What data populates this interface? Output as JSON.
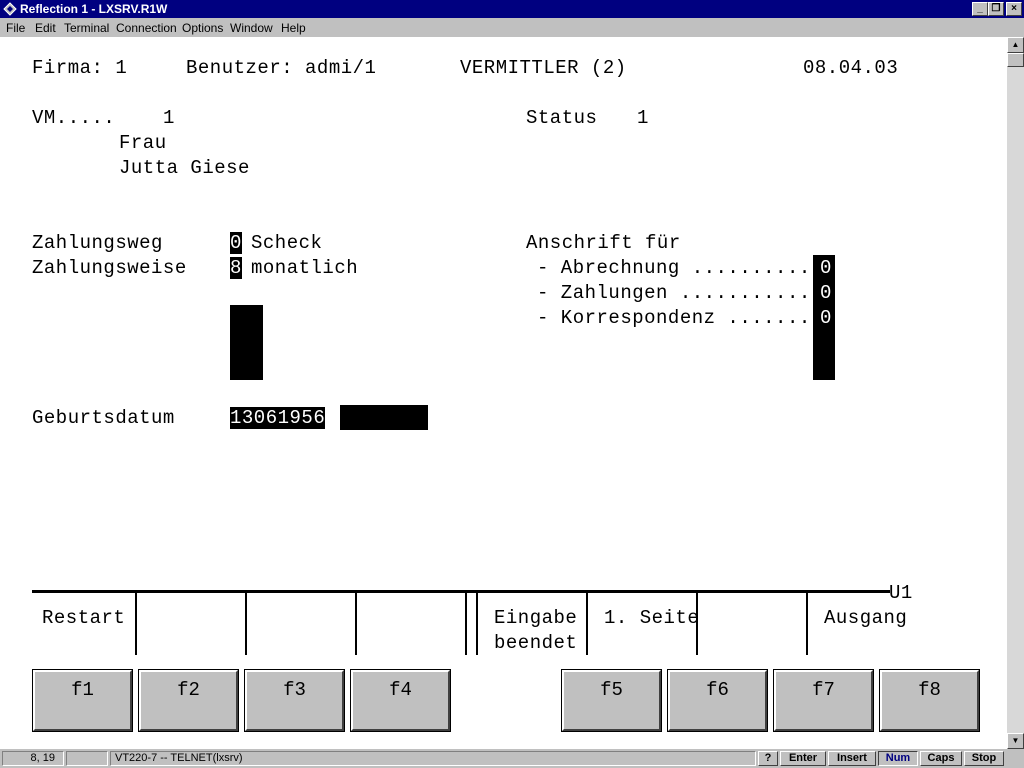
{
  "window": {
    "title": "Reflection 1 - LXSRV.R1W"
  },
  "menu": [
    "File",
    "Edit",
    "Terminal",
    "Connection",
    "Options",
    "Window",
    "Help"
  ],
  "header": {
    "firma": "Firma: 1",
    "benutzer": "Benutzer: admi/1",
    "screen_title": "VERMITTLER (2)",
    "date": "08.04.03"
  },
  "record": {
    "vm_label": "VM.....",
    "vm_value": "1",
    "status_label": "Status",
    "status_value": "1",
    "salutation": "Frau",
    "name": "Jutta Giese"
  },
  "payment": {
    "weg_label": "Zahlungsweg",
    "weg_value": "0",
    "weg_text": "Scheck",
    "weise_label": "Zahlungsweise",
    "weise_value": "8",
    "weise_text": "monatlich"
  },
  "address": {
    "header": "Anschrift für",
    "rows": [
      {
        "label": "- Abrechnung ..........",
        "value": "0"
      },
      {
        "label": "- Zahlungen ...........",
        "value": "0"
      },
      {
        "label": "- Korrespondenz .......",
        "value": "0"
      }
    ]
  },
  "birth": {
    "label": "Geburtsdatum",
    "value": "13061956"
  },
  "screen_id": "U1",
  "softkeys": {
    "f1": "Restart",
    "f5_line1": "Eingabe",
    "f5_line2": "beendet",
    "f6": "1. Seite",
    "f8": "Ausgang"
  },
  "fkeys": [
    "f1",
    "f2",
    "f3",
    "f4",
    "f5",
    "f6",
    "f7",
    "f8"
  ],
  "status": {
    "cursor": "8, 19",
    "session": "VT220-7 -- TELNET(lxsrv)",
    "indicators": [
      "?",
      "Enter",
      "Insert",
      "Num",
      "Caps",
      "Stop"
    ],
    "active": "Num"
  },
  "colors": {
    "titlebar": "#000080",
    "chrome": "#c0c0c0",
    "terminal_bg": "#ffffff"
  }
}
